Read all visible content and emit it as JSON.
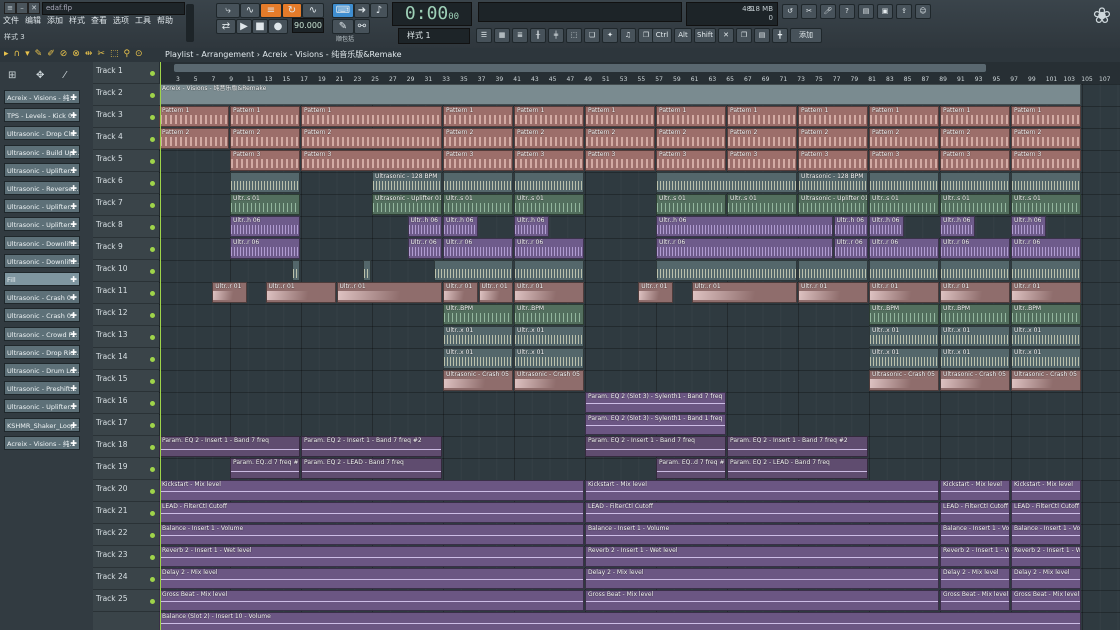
{
  "window": {
    "file_name": "edaf.flp",
    "pattern_label": "样式 3"
  },
  "menu": [
    "文件",
    "编辑",
    "添加",
    "样式",
    "查看",
    "选项",
    "工具",
    "帮助"
  ],
  "transport": {
    "time": "0:00",
    "time_sub": "00",
    "tempo": "90.000",
    "pattern_selector": "样式 1",
    "snap_label": "顺包括"
  },
  "status": {
    "memory": "4818 MB",
    "cpu_a": "5",
    "cpu_b": "0"
  },
  "toolbar_keys": [
    "Ctrl",
    "Alt",
    "Shift"
  ],
  "toolbar_add": "添加",
  "breadcrumb": "Playlist - Arrangement › Acreix - Visions - 纯音乐版&Remake",
  "ruler_numbers": [
    "3",
    "5",
    "7",
    "9",
    "11",
    "13",
    "15",
    "17",
    "19",
    "21",
    "23",
    "25",
    "27",
    "29",
    "31",
    "33",
    "35",
    "37",
    "39",
    "41",
    "43",
    "45",
    "47",
    "49",
    "51",
    "53",
    "55",
    "57",
    "59",
    "61",
    "63",
    "65",
    "67",
    "69",
    "71",
    "73",
    "75",
    "77",
    "79",
    "81",
    "83",
    "85",
    "87",
    "89",
    "91",
    "93",
    "95",
    "97",
    "99",
    "101",
    "103",
    "105",
    "107"
  ],
  "channels": [
    "Acreix - Visions - 纯...",
    "TPS - Levels - Kick 02",
    "Ultrasonic - Drop Cla...",
    "Ultrasonic - Build Up...",
    "Ultrasonic - Uplifter...",
    "Ultrasonic - Reverse...",
    "Ultrasonic - Uplifter...",
    "Ultrasonic - Uplifter...",
    "Ultrasonic - Downlift...",
    "Ultrasonic - Downlift...",
    "Fill",
    "Ultrasonic - Crash 04",
    "Ultrasonic - Crash 05",
    "Ultrasonic - Crowd F...",
    "Ultrasonic - Drop Rid...",
    "Ultrasonic - Drum Lo...",
    "Ultrasonic - Preshift...",
    "Ultrasonic - Uplifter...",
    "KSHMR_Shaker_Loop...",
    "Acreix - Visions - 纯..."
  ],
  "tracks": [
    "Track 1",
    "Track 2",
    "Track 3",
    "Track 4",
    "Track 5",
    "Track 6",
    "Track 7",
    "Track 8",
    "Track 9",
    "Track 10",
    "Track 11",
    "Track 12",
    "Track 13",
    "Track 14",
    "Track 15",
    "Track 16",
    "Track 17",
    "Track 18",
    "Track 19",
    "Track 20",
    "Track 21",
    "Track 22",
    "Track 23",
    "Track 24",
    "Track 25"
  ],
  "clip_labels": {
    "t1": "Acreix - Visions - 纯音乐版&Remake",
    "p1": "Pattern 1",
    "p2": "Pattern 2",
    "p3": "Pattern 3",
    "ultra_bpm": "Ultrasonic - 128 BPM",
    "ultr_s01": "Ultr..s 01",
    "uplifter01": "Ultrasonic - Uplifter 01",
    "ultr_h06": "Ultr..h 06",
    "ultr_r06": "Ultr..r 06",
    "ultr_bpm": "Ultr..BPM",
    "ultr_r01": "Ultr..r 01",
    "ultr_x01": "Ultr..x 01",
    "crash05": "Ultrasonic - Crash 05",
    "eq_slot3": "Param. EQ 2 (Slot 3) - Sylenth1 - Band 7 freq",
    "eq_slot3b": "Param. EQ 2 (Slot 3) - Sylenth1 - Band 1 freq",
    "eq_insert1": "Param. EQ 2 - Insert 1 - Band 7 freq",
    "eq_insert1b": "Param. EQ 2 - Insert 1 - Band 7 freq #2",
    "eq_lead": "Param. EQ 2 - LEAD - Band 7 freq",
    "eq_lead_s": "Param. EQ..d 7 freq #2",
    "kickstart": "Kickstart - Mix level",
    "lead_cutoff": "LEAD - FilterCtl Cutoff",
    "balance": "Balance - Insert 1 - Volume",
    "reverb": "Reverb 2 - Insert 1 - Wet level",
    "delay": "Delay 2 - Mix level",
    "gross": "Gross Beat - Mix level",
    "balance_slot2": "Balance (Slot 2) - Insert 10 - Volume"
  }
}
